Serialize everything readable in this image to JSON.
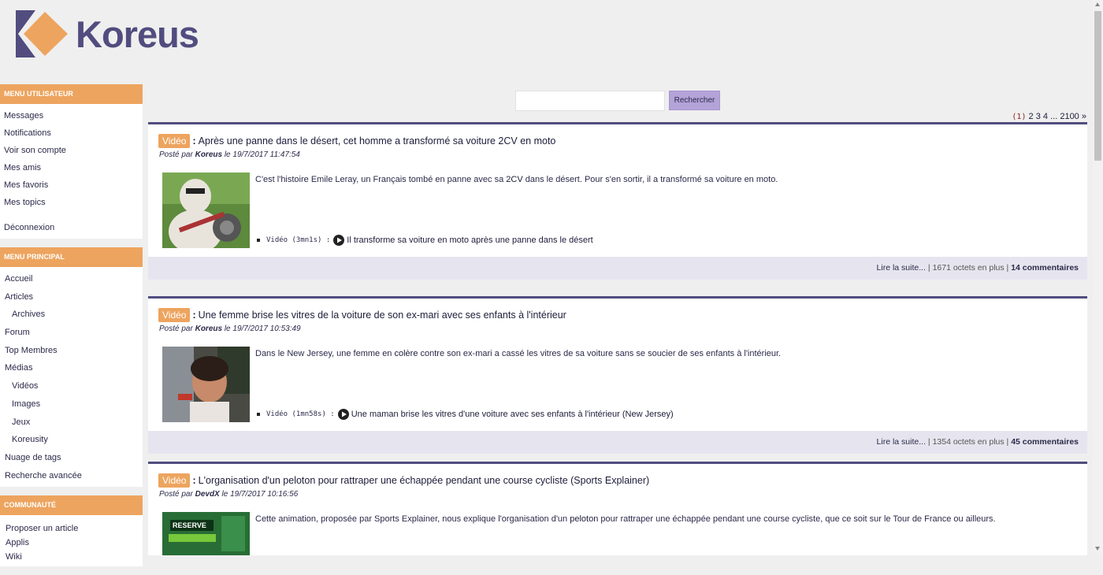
{
  "logo": {
    "text": "Koreus"
  },
  "menus": [
    {
      "header": "Menu utilisateur",
      "items": [
        {
          "label": "Messages"
        },
        {
          "label": "Notifications"
        },
        {
          "label": "Voir son compte"
        },
        {
          "label": "Mes amis"
        },
        {
          "label": "Mes favoris"
        },
        {
          "label": "Mes topics"
        },
        {
          "label": "Déconnexion"
        }
      ]
    },
    {
      "header": "Menu principal",
      "items": [
        {
          "label": "Accueil"
        },
        {
          "label": "Articles"
        },
        {
          "label": "Archives"
        },
        {
          "label": "Forum"
        },
        {
          "label": "Top Membres"
        },
        {
          "label": "Médias"
        },
        {
          "label": "Vidéos"
        },
        {
          "label": "Images"
        },
        {
          "label": "Jeux"
        },
        {
          "label": "Koreusity"
        },
        {
          "label": "Nuage de tags"
        },
        {
          "label": "Recherche avancée"
        }
      ]
    },
    {
      "header": "Communauté",
      "items": [
        {
          "label": "Proposer un article"
        },
        {
          "label": "Applis"
        },
        {
          "label": "Wiki"
        }
      ]
    }
  ],
  "search": {
    "value": "",
    "button_label": "Rechercher"
  },
  "pagination": {
    "current": "(1)",
    "pages": [
      "2",
      "3",
      "4"
    ],
    "ellipsis": "...",
    "last": "2100",
    "next": "»"
  },
  "articles": [
    {
      "badge": "Vidéo",
      "colon": ":",
      "title": "Après une panne dans le désert, cet homme a transformé sa voiture 2CV en moto",
      "posted_by": "Posté par",
      "author": "Koreus",
      "on": "le",
      "date": "19/7/2017 11:47:54",
      "text_before": "C'est l'histoire Emile Leray, un Français tombé en panne avec sa ",
      "keyword": "2CV",
      "text_after": " dans le désert. Pour s'en sortir, il a transformé sa voiture en moto.",
      "video_label": "Vidéo (3mn1s) :",
      "video_title": "Il transforme sa voiture en moto après une panne dans le désert",
      "read_more": "Lire la suite...",
      "extra_bytes": "1671 octets en plus",
      "comments": "14 commentaires",
      "thumb_colors": {
        "bg": "#5d8a3c",
        "accent": "#e8e4dc"
      }
    },
    {
      "badge": "Vidéo",
      "colon": ":",
      "title": "Une femme brise les vitres de la voiture de son ex-mari avec ses enfants à l'intérieur",
      "posted_by": "Posté par",
      "author": "Koreus",
      "on": "le",
      "date": "19/7/2017 10:53:49",
      "text_before": "Dans le New Jersey, une femme en ",
      "keyword": "colère",
      "text_after": " contre son ex-mari a cassé les vitres de sa voiture sans se soucier de ses enfants à l'intérieur.",
      "video_label": "Vidéo (1mn58s) :",
      "video_title": "Une maman brise les vitres d'une voiture avec ses enfants à l'intérieur (New Jersey)",
      "read_more": "Lire la suite...",
      "extra_bytes": "1354 octets en plus",
      "comments": "45 commentaires",
      "thumb_colors": {
        "bg": "#4a4a44",
        "accent": "#c78a6a"
      }
    },
    {
      "badge": "Vidéo",
      "colon": ":",
      "title": "L'organisation d'un peloton pour rattraper une échappée pendant une course cycliste (Sports Explainer)",
      "posted_by": "Posté par",
      "author": "DevdX",
      "on": "le",
      "date": "19/7/2017 10:16:56",
      "text_before": "Cette animation, proposée par Sports Explainer, nous explique l'organisation d'un ",
      "keyword": "peloton",
      "text_after": " pour rattraper une échappée pendant une course cycliste, que ce soit sur le Tour de France ou ailleurs.",
      "thumb_colors": {
        "bg": "#1f5a2e",
        "accent": "#7fd13b"
      },
      "thumb_text": "RESERVE"
    }
  ],
  "colors": {
    "accent_orange": "#eda45e",
    "brand_purple": "#514d7f",
    "button_lilac": "#b3a3d8",
    "footer_bg": "#e6e5ef"
  }
}
